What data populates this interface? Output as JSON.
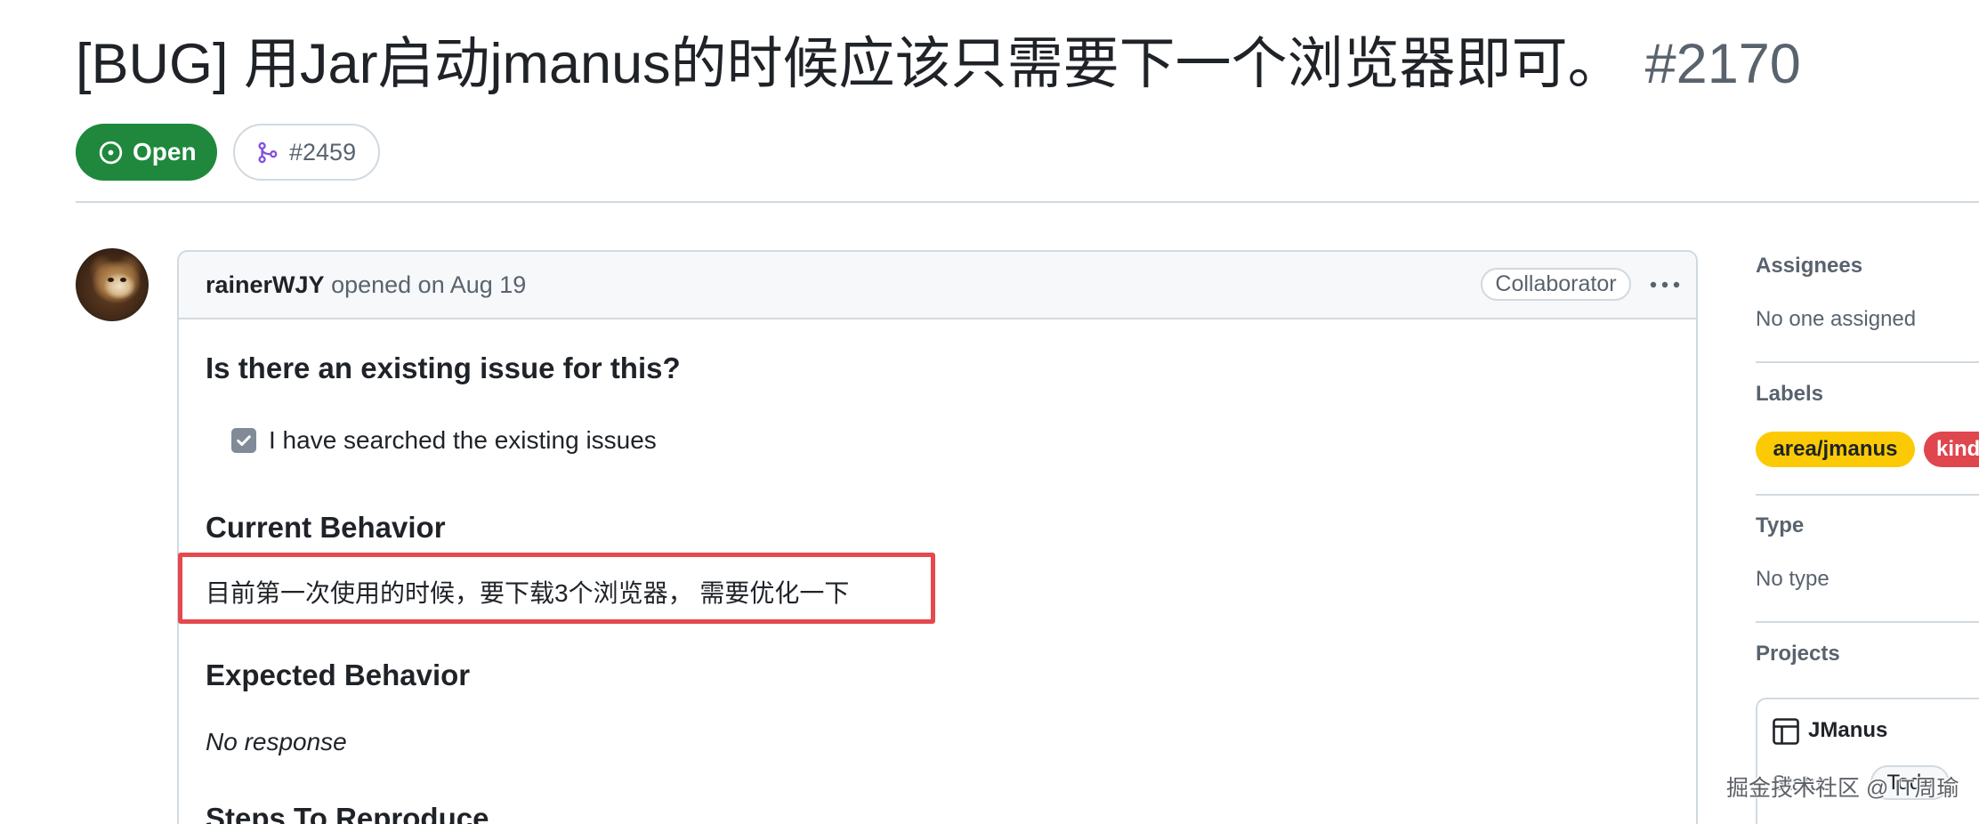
{
  "issue": {
    "title": "[BUG] 用Jar启动jmanus的时候应该只需要下一个浏览器即可。",
    "number": "#2170",
    "state_label": "Open",
    "linked_pull_request": "#2459"
  },
  "comment": {
    "author": "rainerWJY",
    "meta": "opened on Aug 19",
    "author_role": "Collaborator",
    "body": {
      "existing_issue": {
        "heading": "Is there an existing issue for this?",
        "checkbox_label": "I have searched the existing issues",
        "checked": true
      },
      "current_behavior": {
        "heading": "Current Behavior",
        "text": "目前第一次使用的时候，要下载3个浏览器， 需要优化一下",
        "highlighted": true
      },
      "expected_behavior": {
        "heading": "Expected Behavior",
        "text": "No response"
      },
      "steps_to_reproduce": {
        "heading": "Steps To Reproduce"
      }
    }
  },
  "sidebar": {
    "assignees": {
      "heading": "Assignees",
      "value": "No one assigned"
    },
    "labels": {
      "heading": "Labels",
      "items": [
        {
          "name": "area/jmanus",
          "color": "#fbca04",
          "text_color": "#1f2328"
        },
        {
          "name": "kind",
          "color": "#e0464e",
          "text_color": "#ffffff"
        }
      ]
    },
    "type": {
      "heading": "Type",
      "value": "No type"
    },
    "projects": {
      "heading": "Projects",
      "items": [
        {
          "name": "JManus",
          "field": "Status",
          "value": "Todo"
        }
      ]
    }
  },
  "watermark": "掘金技术社区 @ IT周瑜",
  "theme": {
    "open_green": "#1f883d",
    "merged_purple": "#8250df",
    "annotation_red": "#e5484d",
    "text_primary": "#1f2328",
    "text_muted": "#59636e",
    "border": "#d1d9e0",
    "header_bg": "#f6f8fa"
  },
  "icons": {
    "state": "issue-opened-icon",
    "linked_pull_request": "git-merge-icon",
    "comment_menu": "kebab-horizontal-icon",
    "checkbox": "check-icon",
    "project": "table-icon"
  }
}
